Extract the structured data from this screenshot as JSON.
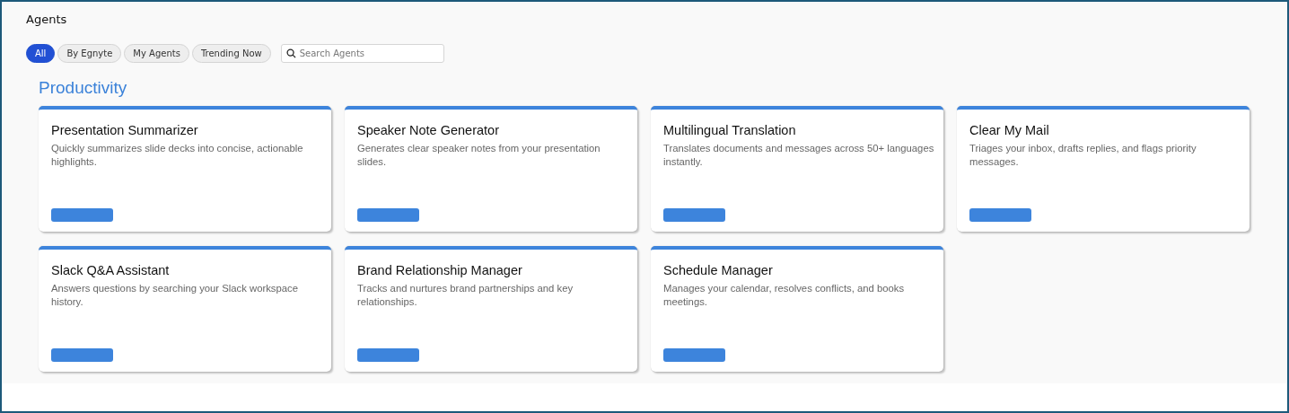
{
  "page": {
    "title": "Agents"
  },
  "filters": [
    {
      "label": "All",
      "selected": true
    },
    {
      "label": "By Egnyte",
      "selected": false
    },
    {
      "label": "My Agents",
      "selected": false
    },
    {
      "label": "Trending Now",
      "selected": false
    }
  ],
  "search": {
    "placeholder": "Search Agents"
  },
  "section": {
    "title": "Productivity",
    "cards": [
      {
        "title": "Presentation Summarizer",
        "description": "Quickly summarizes slide decks into concise, actionable highlights."
      },
      {
        "title": "Speaker Note Generator",
        "description": "Generates clear speaker notes from your presentation slides."
      },
      {
        "title": "Multilingual Translation",
        "description": "Translates documents and messages across 50+ languages instantly."
      },
      {
        "title": "Clear My Mail",
        "description": "Triages your inbox, drafts replies, and flags priority messages."
      },
      {
        "title": "Slack Q&A Assistant",
        "description": "Answers questions by searching your Slack workspace history."
      },
      {
        "title": "Brand Relationship Manager",
        "description": "Tracks and nurtures brand partnerships and key relationships."
      },
      {
        "title": "Schedule Manager",
        "description": "Manages your calendar, resolves conflicts, and books meetings."
      }
    ]
  }
}
